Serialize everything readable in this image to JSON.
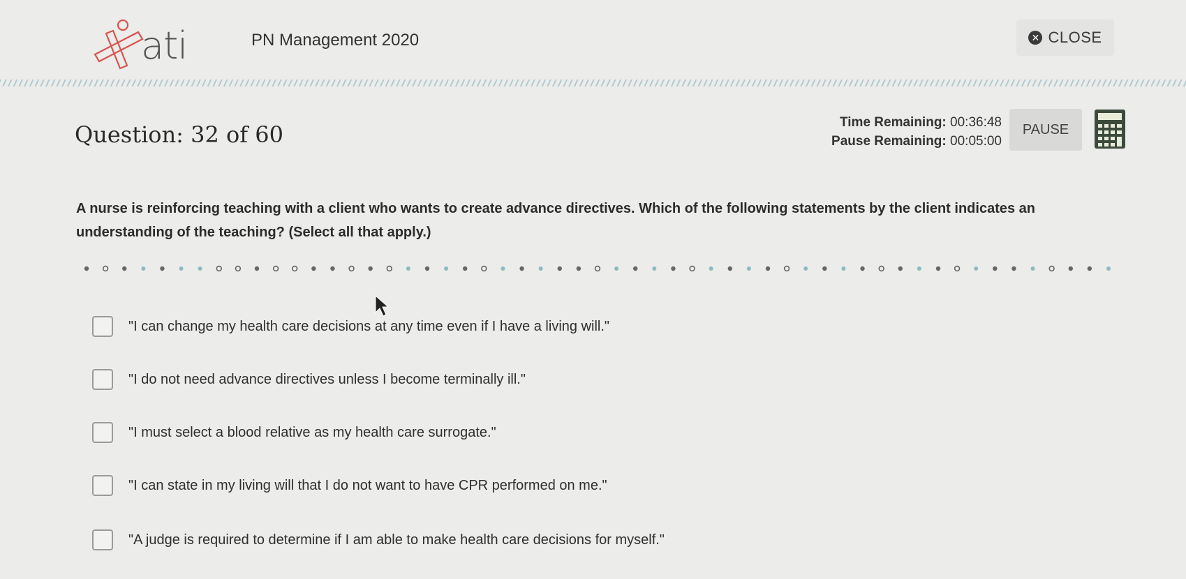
{
  "header": {
    "logo_text": "ati",
    "app_title": "PN Management 2020",
    "close_label": "CLOSE"
  },
  "question": {
    "number_label": "Question: 32 of 60",
    "stem": "A nurse is reinforcing teaching with a client who wants to create advance directives. Which of the following statements by the client indicates an understanding of the teaching? (Select all that apply.)",
    "options": [
      {
        "text": "\"I can change my health care decisions at any time even if I have a living will.\"",
        "checked": false
      },
      {
        "text": "\"I do not need advance directives unless I become terminally ill.\"",
        "checked": false
      },
      {
        "text": "\"I must select a blood relative as my health care surrogate.\"",
        "checked": false
      },
      {
        "text": "\"I can state in my living will that I do not want to have CPR performed on me.\"",
        "checked": false
      },
      {
        "text": "\"A judge is required to determine if I am able to make health care decisions for myself.\"",
        "checked": false
      }
    ]
  },
  "timers": {
    "time_label": "Time Remaining:",
    "time_value": "00:36:48",
    "pause_label": "Pause Remaining:",
    "pause_value": "00:05:00"
  },
  "controls": {
    "pause_label": "PAUSE"
  },
  "colors": {
    "background": "#ececea",
    "divider": "#a9c4cc",
    "logo_accent": "#d9534f",
    "dot_dark": "#666666",
    "dot_teal": "#8fb9c2"
  }
}
